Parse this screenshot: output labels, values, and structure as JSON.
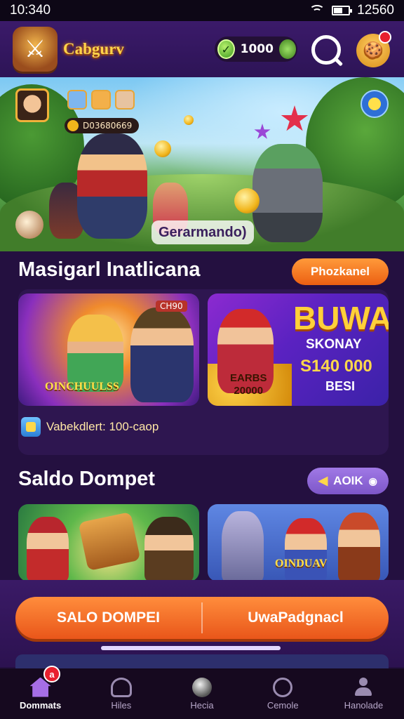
{
  "status": {
    "time": "10:340",
    "battery_text": "12560"
  },
  "header": {
    "app_name": "Cabgurv",
    "coin_balance": "1000"
  },
  "hero": {
    "chip_text": "D03680669",
    "caption": "Gerarmando)"
  },
  "section1": {
    "title": "Masigarl Inatlicana",
    "action_label": "Phozkanel",
    "card1": {
      "tag": "CH90",
      "label": "OINCHUULSS"
    },
    "card2": {
      "label_line1": "EARBS",
      "label_line2": "20000",
      "promo_title": "BUWA",
      "promo_sub": "SKONAY",
      "promo_amount": "S140 000",
      "promo_small": "BESI"
    },
    "reward_text": "Vabekdlert: 100-caop"
  },
  "section2": {
    "title": "Saldo Dompet",
    "action_label": "AOIK",
    "card4_label": "OINDUAV"
  },
  "cta": {
    "left_label": "SALO DOMPEI",
    "right_label": "UwaPadgnacl",
    "progress": 1.0
  },
  "nav": {
    "items": [
      {
        "label": "Dommats",
        "icon": "home-icon",
        "active": true
      },
      {
        "label": "Hiles",
        "icon": "screen-icon",
        "active": false
      },
      {
        "label": "Hecia",
        "icon": "circle-icon",
        "active": false
      },
      {
        "label": "Cemole",
        "icon": "ball-icon",
        "active": false
      },
      {
        "label": "Hanolade",
        "icon": "person-icon",
        "active": false
      }
    ],
    "badge": "a"
  }
}
